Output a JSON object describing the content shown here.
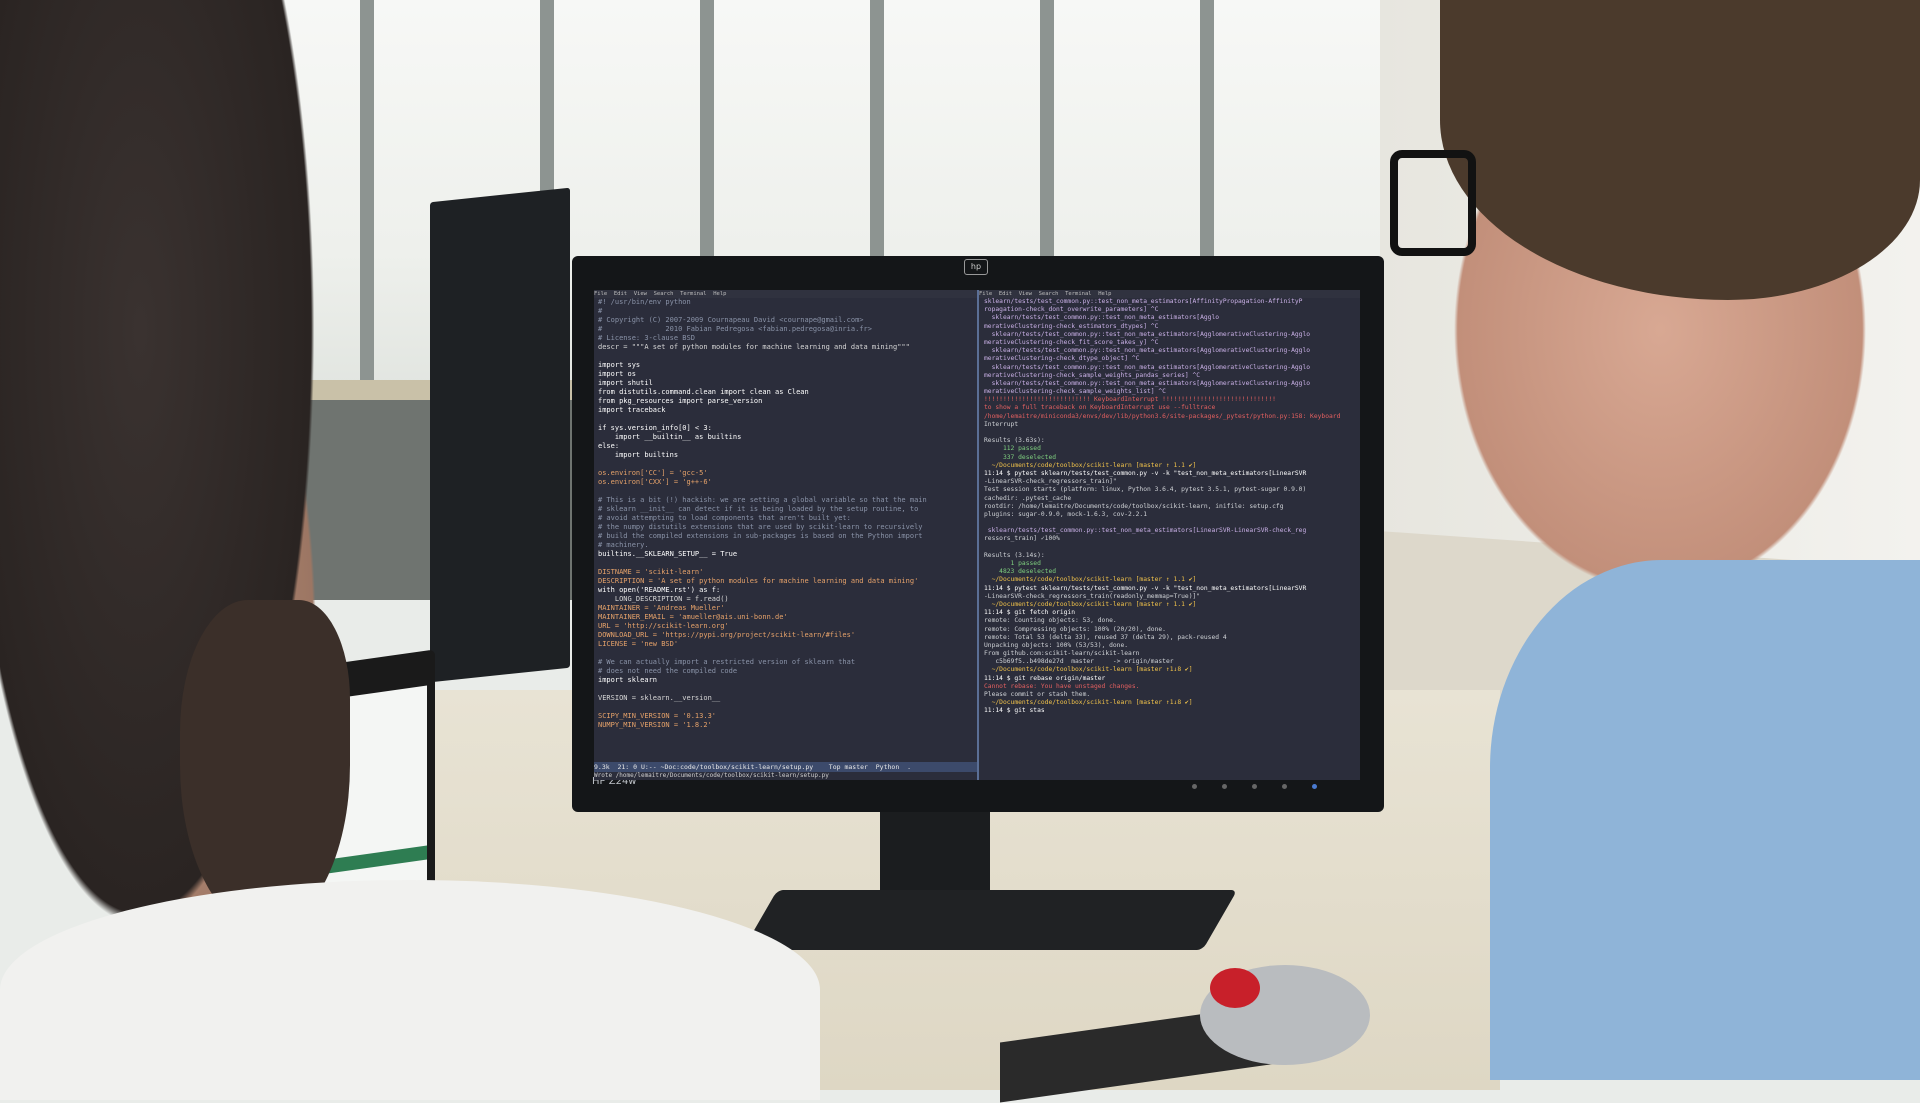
{
  "scene": {
    "description_colors": {
      "screen_bg": "#2b2d3b",
      "keyword": "#ffffff",
      "comment": "#8a93a8",
      "string": "#e6a26a",
      "prompt": "#f0c24a",
      "error": "#e36060",
      "ok": "#7fd07f"
    },
    "monitor": {
      "brand": "HP Z24w",
      "hp_logo": "hp"
    },
    "left_terminal": {
      "menubar": "File  Edit  View  Search  Terminal  Help",
      "lines": [
        "#! /usr/bin/env python",
        "#",
        "# Copyright (C) 2007-2009 Cournapeau David <cournape@gmail.com>",
        "#               2010 Fabian Pedregosa <fabian.pedregosa@inria.fr>",
        "# License: 3-clause BSD",
        "descr = \"\"\"A set of python modules for machine learning and data mining\"\"\"",
        "",
        "import sys",
        "import os",
        "import shutil",
        "from distutils.command.clean import clean as Clean",
        "from pkg_resources import parse_version",
        "import traceback",
        "",
        "if sys.version_info[0] < 3:",
        "    import __builtin__ as builtins",
        "else:",
        "    import builtins",
        "",
        "os.environ['CC'] = 'gcc-5'",
        "os.environ['CXX'] = 'g++-6'",
        "",
        "# This is a bit (!) hackish: we are setting a global variable so that the main",
        "# sklearn __init__ can detect if it is being loaded by the setup routine, to",
        "# avoid attempting to load components that aren't built yet:",
        "# the numpy distutils extensions that are used by scikit-learn to recursively",
        "# build the compiled extensions in sub-packages is based on the Python import",
        "# machinery.",
        "builtins.__SKLEARN_SETUP__ = True",
        "",
        "DISTNAME = 'scikit-learn'",
        "DESCRIPTION = 'A set of python modules for machine learning and data mining'",
        "with open('README.rst') as f:",
        "    LONG_DESCRIPTION = f.read()",
        "MAINTAINER = 'Andreas Mueller'",
        "MAINTAINER_EMAIL = 'amueller@ais.uni-bonn.de'",
        "URL = 'http://scikit-learn.org'",
        "DOWNLOAD_URL = 'https://pypi.org/project/scikit-learn/#files'",
        "LICENSE = 'new BSD'",
        "",
        "# We can actually import a restricted version of sklearn that",
        "# does not need the compiled code",
        "import sklearn",
        "",
        "VERSION = sklearn.__version__",
        "",
        "SCIPY_MIN_VERSION = '0.13.3'",
        "NUMPY_MIN_VERSION = '1.8.2'"
      ],
      "status": "9.3k  21: 0 U:-- ~Doc:code/toolbox/scikit-learn/setup.py    Top master  Python  .",
      "minibuffer": "Wrote /home/lemaitre/Documents/code/toolbox/scikit-learn/setup.py"
    },
    "right_terminal": {
      "menubar": "File  Edit  View  Search  Terminal  Help",
      "lines": [
        "sklearn/tests/test_common.py::test_non_meta_estimators[AffinityPropagation-AffinityP",
        "ropagation-check_dont_overwrite_parameters] ^C",
        "  sklearn/tests/test_common.py::test_non_meta_estimators[Agglo",
        "merativeClustering-check_estimators_dtypes] ^C",
        "  sklearn/tests/test_common.py::test_non_meta_estimators[AgglomerativeClustering-Agglo",
        "merativeClustering-check_fit_score_takes_y] ^C",
        "  sklearn/tests/test_common.py::test_non_meta_estimators[AgglomerativeClustering-Agglo",
        "merativeClustering-check_dtype_object] ^C",
        "  sklearn/tests/test_common.py::test_non_meta_estimators[AgglomerativeClustering-Agglo",
        "merativeClustering-check_sample_weights_pandas_series] ^C",
        "  sklearn/tests/test_common.py::test_non_meta_estimators[AgglomerativeClustering-Agglo",
        "merativeClustering-check_sample_weights_list] ^C",
        "!!!!!!!!!!!!!!!!!!!!!!!!!!!! KeyboardInterrupt !!!!!!!!!!!!!!!!!!!!!!!!!!!!!!",
        "to show a full traceback on KeyboardInterrupt use --fulltrace",
        "/home/lemaitre/miniconda3/envs/dev/lib/python3.6/site-packages/_pytest/python.py:158: Keyboard",
        "Interrupt",
        "",
        "Results (3.63s):",
        "     112 passed",
        "     337 deselected",
        "  ~/Documents/code/toolbox/scikit-learn [master ↑ 1.1 ✔]",
        "11:14 $ pytest sklearn/tests/test_common.py -v -k \"test_non_meta_estimators[LinearSVR",
        "-LinearSVR-check_regressors_train]\"",
        "Test session starts (platform: linux, Python 3.6.4, pytest 3.5.1, pytest-sugar 0.9.0)",
        "cachedir: .pytest_cache",
        "rootdir: /home/lemaitre/Documents/code/toolbox/scikit-learn, inifile: setup.cfg",
        "plugins: sugar-0.9.0, mock-1.6.3, cov-2.2.1",
        "",
        " sklearn/tests/test_common.py::test_non_meta_estimators[LinearSVR-LinearSVR-check_reg",
        "ressors_train] ✓100% ",
        "",
        "Results (3.14s):",
        "       1 passed",
        "    4823 deselected",
        "  ~/Documents/code/toolbox/scikit-learn [master ↑ 1.1 ✔]",
        "11:14 $ pytest sklearn/tests/test_common.py -v -k \"test_non_meta_estimators[LinearSVR",
        "-LinearSVR-check_regressors_train(readonly_memmap=True)]\"",
        "  ~/Documents/code/toolbox/scikit-learn [master ↑ 1.1 ✔]",
        "11:14 $ git fetch origin",
        "remote: Counting objects: 53, done.",
        "remote: Compressing objects: 100% (20/20), done.",
        "remote: Total 53 (delta 33), reused 37 (delta 29), pack-reused 4",
        "Unpacking objects: 100% (53/53), done.",
        "From github.com:scikit-learn/scikit-learn",
        "   c5b69f5..b498de27d  master     -> origin/master",
        "  ~/Documents/code/toolbox/scikit-learn [master ↑1↓8 ✔]",
        "11:14 $ git rebase origin/master",
        "Cannot rebase: You have unstaged changes.",
        "Please commit or stash them.",
        "  ~/Documents/code/toolbox/scikit-learn [master ↑1↓8 ✔]",
        "11:14 $ git stas"
      ]
    }
  }
}
